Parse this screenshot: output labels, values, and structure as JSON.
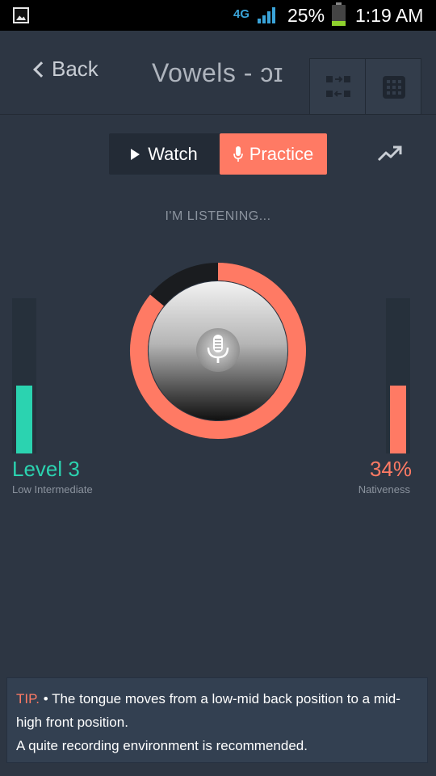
{
  "status_bar": {
    "network": "4G",
    "battery_percent_text": "25%",
    "battery_level": 0.25,
    "time": "1:19 AM"
  },
  "header": {
    "back_label": "Back",
    "title": "Vowels - ɔɪ",
    "buttons": [
      "compare-icon",
      "grid-icon"
    ]
  },
  "mode_toggle": {
    "watch_label": "Watch",
    "practice_label": "Practice",
    "selected": "Practice"
  },
  "status_text": "I'M LISTENING...",
  "dial": {
    "progress_fraction": 0.86,
    "ring_color": "#ff7a64"
  },
  "level": {
    "title": "Level 3",
    "subtitle": "Low Intermediate",
    "fill_fraction": 0.44,
    "color": "#2bd3b0"
  },
  "nativeness": {
    "percent_text": "34%",
    "subtitle": "Nativeness",
    "fill_fraction": 0.44,
    "color": "#ff7a64"
  },
  "tip": {
    "label": "TIP.",
    "line1": "• The tongue moves from a low-mid back position to a mid-high front position.",
    "line2": "A quite recording environment is recommended."
  },
  "colors": {
    "background": "#2d3643",
    "accent": "#ff7a64",
    "teal": "#2bd3b0"
  }
}
